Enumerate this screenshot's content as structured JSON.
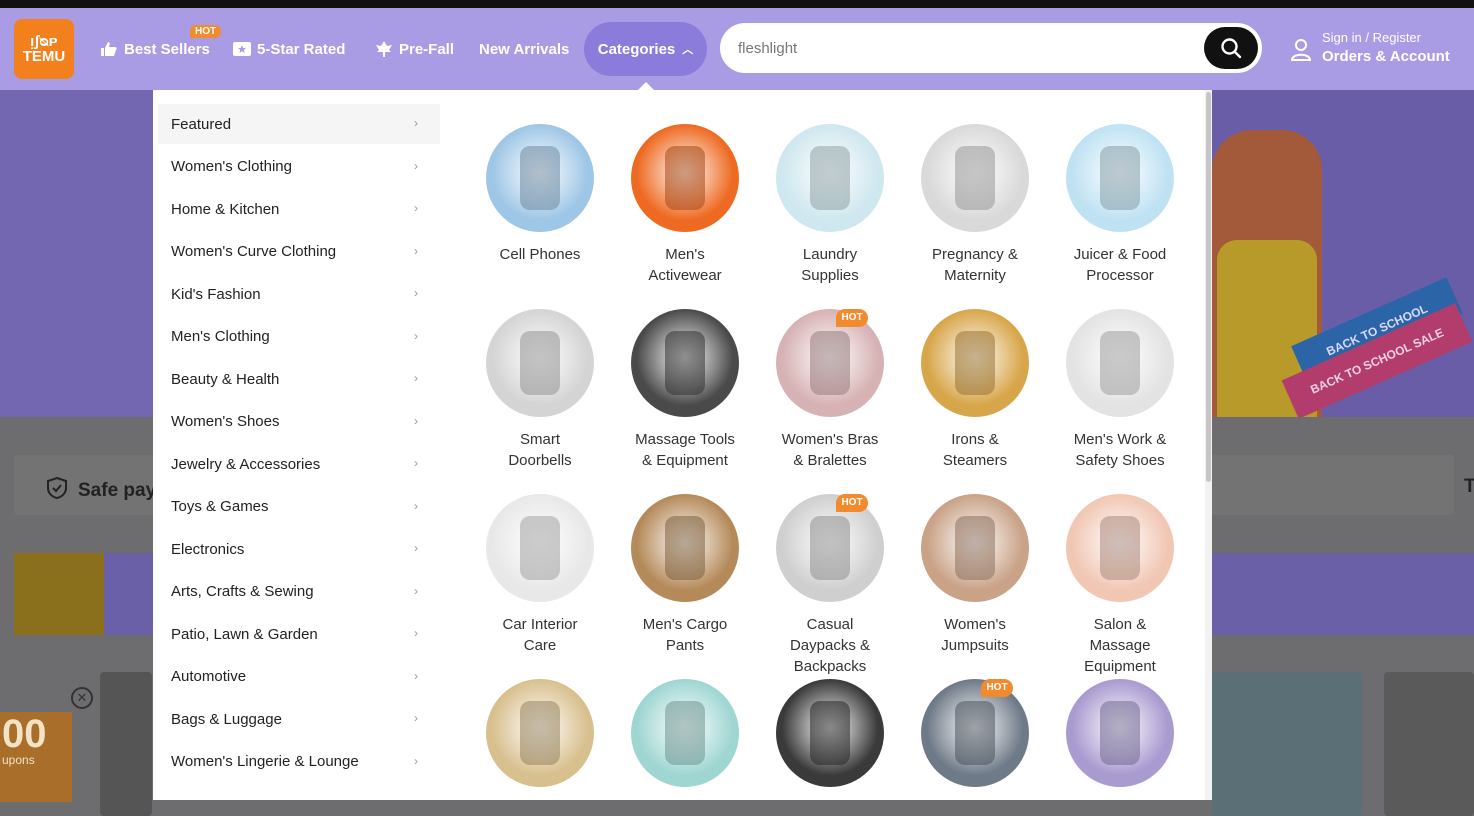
{
  "header": {
    "logo_line1": "ᴉʃᴓᴘ",
    "logo_line2": "TEMU",
    "nav": {
      "best_sellers": "Best Sellers",
      "best_sellers_badge": "HOT",
      "five_star": "5-Star Rated",
      "pre_fall": "Pre-Fall",
      "new_arrivals": "New Arrivals",
      "categories": "Categories"
    },
    "search": {
      "value": "fleshlight"
    },
    "account": {
      "line1": "Sign in / Register",
      "line2": "Orders & Account"
    }
  },
  "background": {
    "safe_text": "Safe pay",
    "right_letter": "T",
    "promo_value": "00",
    "promo_small": "upons",
    "banner_sign1": "BACK TO SCHOOL",
    "banner_sign2": "BACK TO SCHOOL SALE"
  },
  "menu": {
    "categories": [
      "Featured",
      "Women's Clothing",
      "Home & Kitchen",
      "Women's Curve Clothing",
      "Kid's Fashion",
      "Men's Clothing",
      "Beauty & Health",
      "Women's Shoes",
      "Jewelry & Accessories",
      "Toys & Games",
      "Electronics",
      "Arts, Crafts & Sewing",
      "Patio, Lawn & Garden",
      "Automotive",
      "Bags & Luggage",
      "Women's Lingerie & Lounge"
    ],
    "tiles": [
      {
        "line1": "Cell Phones",
        "line2": "",
        "line3": "",
        "hot": "",
        "color": "#9ec6e6"
      },
      {
        "line1": "Men's",
        "line2": "Activewear",
        "line3": "",
        "hot": "",
        "color": "#ee6a22"
      },
      {
        "line1": "Laundry",
        "line2": "Supplies",
        "line3": "",
        "hot": "",
        "color": "#cfe7ef"
      },
      {
        "line1": "Pregnancy &",
        "line2": "Maternity",
        "line3": "",
        "hot": "",
        "color": "#d9d9d9"
      },
      {
        "line1": "Juicer & Food",
        "line2": "Processor",
        "line3": "",
        "hot": "",
        "color": "#bfe2f3"
      },
      {
        "line1": "Smart",
        "line2": "Doorbells",
        "line3": "",
        "hot": "",
        "color": "#d4d4d4"
      },
      {
        "line1": "Massage Tools",
        "line2": "& Equipment",
        "line3": "",
        "hot": "",
        "color": "#4a4a4a"
      },
      {
        "line1": "Women's Bras",
        "line2": "& Bralettes",
        "line3": "",
        "hot": "HOT",
        "color": "#d7b2b4"
      },
      {
        "line1": "Irons &",
        "line2": "Steamers",
        "line3": "",
        "hot": "",
        "color": "#d8a64a"
      },
      {
        "line1": "Men's Work &",
        "line2": "Safety Shoes",
        "line3": "",
        "hot": "",
        "color": "#e3e3e3"
      },
      {
        "line1": "Car Interior",
        "line2": "Care",
        "line3": "",
        "hot": "",
        "color": "#e8e8e8"
      },
      {
        "line1": "Men's Cargo",
        "line2": "Pants",
        "line3": "",
        "hot": "",
        "color": "#b58a5a"
      },
      {
        "line1": "Casual",
        "line2": "Daypacks &",
        "line3": "Backpacks",
        "hot": "HOT",
        "color": "#cfcfcf"
      },
      {
        "line1": "Women's",
        "line2": "Jumpsuits",
        "line3": "",
        "hot": "",
        "color": "#c9a287"
      },
      {
        "line1": "Salon &",
        "line2": "Massage",
        "line3": "Equipment",
        "hot": "",
        "color": "#f1c7b4"
      },
      {
        "line1": "",
        "line2": "",
        "line3": "",
        "hot": "",
        "color": "#d8c08e"
      },
      {
        "line1": "",
        "line2": "",
        "line3": "",
        "hot": "",
        "color": "#9fd6d2"
      },
      {
        "line1": "",
        "line2": "",
        "line3": "",
        "hot": "",
        "color": "#3a3a3a"
      },
      {
        "line1": "",
        "line2": "",
        "line3": "",
        "hot": "HOT",
        "color": "#6f7a88"
      },
      {
        "line1": "",
        "line2": "",
        "line3": "",
        "hot": "",
        "color": "#a99ad0"
      }
    ]
  },
  "colors": {
    "header": "#a99ce4",
    "brand_orange": "#f2811d",
    "pill": "#8b7cdc"
  }
}
